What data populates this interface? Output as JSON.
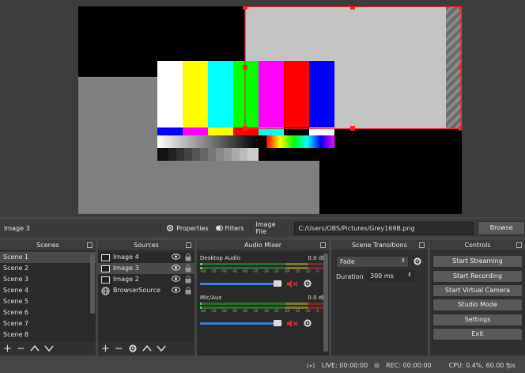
{
  "source_toolbar": {
    "selected_source": "Image 3",
    "properties_label": "Properties",
    "filters_label": "Filters",
    "image_file_label": "Image File",
    "image_file_path": "C:/Users/OBS/Pictures/Grey169B.png",
    "browse_label": "Browse"
  },
  "scenes": {
    "title": "Scenes",
    "items": [
      "Scene 1",
      "Scene 2",
      "Scene 3",
      "Scene 4",
      "Scene 5",
      "Scene 6",
      "Scene 7",
      "Scene 8"
    ]
  },
  "sources": {
    "title": "Sources",
    "items": [
      "Image 4",
      "Image 3",
      "Image 2",
      "BrowserSource"
    ]
  },
  "audio_mixer": {
    "title": "Audio Mixer",
    "channels": [
      {
        "name": "Desktop Audio",
        "db": "0.0 dB",
        "volume": 0.95
      },
      {
        "name": "Mic/Aux",
        "db": "0.0 dB",
        "volume": 0.95
      }
    ],
    "ticks": [
      "-60",
      "-55",
      "-50",
      "-45",
      "-40",
      "-35",
      "-30",
      "-25",
      "-20",
      "-15",
      "-10",
      "-5",
      "0"
    ]
  },
  "transitions": {
    "title": "Scene Transitions",
    "selected": "Fade",
    "duration_label": "Duration",
    "duration_value": "300 ms"
  },
  "controls": {
    "title": "Controls",
    "start_streaming": "Start Streaming",
    "start_recording": "Start Recording",
    "start_virtual_camera": "Start Virtual Camera",
    "studio_mode": "Studio Mode",
    "settings": "Settings",
    "exit": "Exit"
  },
  "status": {
    "live": "LIVE: 00:00:00",
    "rec": "REC: 00:00:00",
    "cpu": "CPU: 0.4%, 60.00 fps"
  },
  "colors": {
    "selection": "#ff2020",
    "slider": "#3b7fd4",
    "mute": "#d03030"
  }
}
